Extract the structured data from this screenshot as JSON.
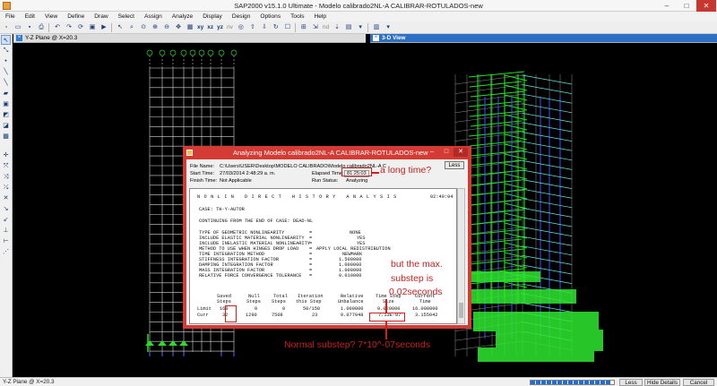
{
  "app": {
    "title": "SAP2000 v15.1.0 Ultimate  - Modelo calibrado2NL-A CALIBRAR-ROTULADOS-new",
    "window_controls": [
      "–",
      "□",
      "✕"
    ]
  },
  "menu": [
    "File",
    "Edit",
    "View",
    "Define",
    "Draw",
    "Select",
    "Assign",
    "Analyze",
    "Display",
    "Design",
    "Options",
    "Tools",
    "Help"
  ],
  "toolbar": {
    "icons": [
      "new-file-icon",
      "open-file-icon",
      "save-icon",
      "print-icon",
      "undo-icon",
      "redo-icon",
      "refresh-icon",
      "lock-icon",
      "run-analysis-icon",
      "pointer-icon",
      "rubberband-zoom-icon",
      "restore-zoom-icon",
      "zoom-in-icon",
      "zoom-out-icon",
      "pan-icon",
      "3d-view-icon"
    ],
    "view_labels": [
      "xy",
      "xz",
      "yz",
      "nv"
    ],
    "more_icons": [
      "perspective-icon",
      "move-up-icon",
      "move-down-icon",
      "rotate-icon",
      "view-options-icon",
      "show-undeformed-icon",
      "show-forces-icon",
      "show-deformed-icon"
    ],
    "dropdown_label": "nd"
  },
  "left_tools": [
    "pointer-tool-icon",
    "reshape-tool-icon",
    "draw-joint-icon",
    "draw-frame-icon",
    "draw-line-icon",
    "draw-area-icon",
    "draw-rectangle-icon",
    "draw-quad-icon",
    "draw-poly-icon",
    "draw-solid-icon",
    "select-all-icon",
    "select-previous-icon",
    "clear-selection-icon",
    "select-intersect-icon",
    "snap-points-icon",
    "snap-ends-icon",
    "snap-middle-icon",
    "snap-intersections-icon",
    "snap-perpendicular-icon",
    "snap-lines-icon"
  ],
  "views": {
    "left_tab": "Y-Z Plane @ X=20.3",
    "right_tab": "3-D View"
  },
  "dialog": {
    "title": "Analyzing Modelo calibrado2NL-A CALIBRAR-ROTULADOS-new",
    "less_button": "Less",
    "file_name_label": "File Name:",
    "file_name_value": "C:\\Users\\USER\\Desktop\\MODELO CALIBRADO\\Modelo calibrado2NL-A C",
    "start_time_label": "Start Time:",
    "start_time_value": "27/03/2014 2:48:29 a. m.",
    "elapsed_time_label": "Elapsed Time:",
    "elapsed_time_value": "81:25:03",
    "finish_time_label": "Finish Time:",
    "finish_time_value": "Not Applicable",
    "run_status_label": "Run Status:",
    "run_status_value": "Analyzing",
    "log": {
      "header": "N O N L I N   D I R E C T   H I S T O R Y   A N A L Y S I S",
      "header_time": "02:49:04",
      "case": "CASE: TH-Y-AUTOR",
      "continuing": "CONTINUING FROM THE END OF CASE: DEAD-NL",
      "params": [
        {
          "name": "TYPE OF GEOMETRIC NONLINEARITY",
          "value": "NONE"
        },
        {
          "name": "INCLUDE ELASTIC MATERIAL NONLINEARITY",
          "value": "YES"
        },
        {
          "name": "INCLUDE INELASTIC MATERIAL NONLINEARITY",
          "value": "YES"
        },
        {
          "name": "METHOD TO USE WHEN HINGES DROP LOAD",
          "value": "APPLY LOCAL REDISTRIBUTION"
        },
        {
          "name": "TIME INTEGRATION METHOD",
          "value": "NEWMARK"
        },
        {
          "name": "STIFFNESS INTEGRATION FACTOR",
          "value": "1.500000"
        },
        {
          "name": "DAMPING INTEGRATION FACTOR",
          "value": "1.000000"
        },
        {
          "name": "MASS INTEGRATION FACTOR",
          "value": "1.000000"
        },
        {
          "name": "RELATIVE FORCE CONVERGENCE TOLERANCE",
          "value": "0.010000"
        }
      ],
      "table_header_1": [
        "Saved",
        "Null",
        "Total",
        "Iteration",
        "Relative",
        "Time Step",
        "Current"
      ],
      "table_header_2": [
        "Steps",
        "Steps",
        "Steps",
        "this Step",
        "Unbalance",
        "Size",
        "Time"
      ],
      "rows": [
        {
          "label": "Limit",
          "saved": "160",
          "null": "0",
          "total": "0",
          "iteration": "50/150",
          "unbalance": "1.000000",
          "step": "0.020000",
          "time": "16.000000"
        },
        {
          "label": "Curr",
          "saved": "32",
          "null": "1290",
          "total": "7508",
          "iteration": "23",
          "unbalance": "0.077048",
          "step": "7.13E-07",
          "time": "3.155042"
        }
      ]
    }
  },
  "annotations": {
    "long_time": "a long time?",
    "max_substep_1": "but the max.",
    "max_substep_2": "substep is",
    "max_substep_3": "0.02seconds",
    "normal_substep": "Normal substep? 7*10^-07seconds"
  },
  "status": {
    "text": "Y-Z Plane @ X=20.3",
    "progress": 0.97,
    "less_button": "Less",
    "hide_details_button": "Hide Details",
    "cancel_button": "Cancel"
  }
}
